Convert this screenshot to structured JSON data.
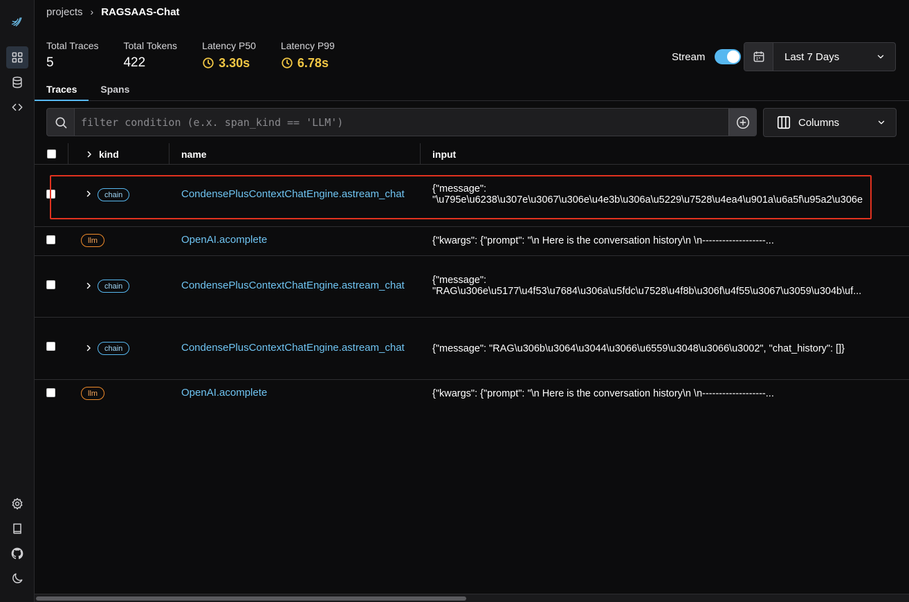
{
  "breadcrumb": {
    "parent": "projects",
    "separator": "›",
    "current": "RAGSAAS-Chat"
  },
  "stats": [
    {
      "label": "Total Traces",
      "value": "5"
    },
    {
      "label": "Total Tokens",
      "value": "422"
    },
    {
      "label": "Latency P50",
      "value": "3.30s"
    },
    {
      "label": "Latency P99",
      "value": "6.78s"
    }
  ],
  "stream": {
    "label": "Stream",
    "enabled": true
  },
  "date_picker": {
    "selected": "Last 7 Days"
  },
  "tabs": [
    {
      "label": "Traces",
      "active": true
    },
    {
      "label": "Spans",
      "active": false
    }
  ],
  "filter": {
    "placeholder": "filter condition (e.x. span_kind == 'LLM')",
    "value": ""
  },
  "columns_button": {
    "label": "Columns"
  },
  "table": {
    "headers": [
      "kind",
      "name",
      "input"
    ],
    "rows": [
      {
        "kind": "chain",
        "name": "CondensePlusContextChatEngine.astream_chat",
        "input_line1": "{\"message\":",
        "input_line2": "\"\\u795e\\u6238\\u307e\\u3067\\u306e\\u4e3b\\u306a\\u5229\\u7528\\u4ea4\\u901a\\u6a5f\\u95a2\\u306e"
      },
      {
        "kind": "llm",
        "name": "OpenAI.acomplete",
        "input_line1": "{\"kwargs\": {\"prompt\": \"\\n Here is the conversation history\\n \\n-------------------...",
        "input_line2": ""
      },
      {
        "kind": "chain",
        "name": "CondensePlusContextChatEngine.astream_chat",
        "input_line1": "{\"message\":",
        "input_line2": "\"RAG\\u306e\\u5177\\u4f53\\u7684\\u306a\\u5fdc\\u7528\\u4f8b\\u306f\\u4f55\\u3067\\u3059\\u304b\\uf..."
      },
      {
        "kind": "chain",
        "name": "CondensePlusContextChatEngine.astream_chat",
        "input_line1": "{\"message\": \"RAG\\u306b\\u3064\\u3044\\u3066\\u6559\\u3048\\u3066\\u3002\", \"chat_history\": []}",
        "input_line2": ""
      },
      {
        "kind": "llm",
        "name": "OpenAI.acomplete",
        "input_line1": "{\"kwargs\": {\"prompt\": \"\\n Here is the conversation history\\n \\n-------------------...",
        "input_line2": ""
      }
    ]
  },
  "colors": {
    "accent": "#57b8f0",
    "latency": "#f2c744",
    "chain_badge": "#57b8f0",
    "llm_badge": "#f08b2a",
    "highlight": "#e1321f"
  },
  "icons": {
    "sidebar_top": [
      "bird-logo-icon",
      "grid-icon",
      "database-icon",
      "code-icon"
    ],
    "sidebar_bottom": [
      "gear-icon",
      "book-icon",
      "github-icon",
      "moon-icon"
    ]
  }
}
